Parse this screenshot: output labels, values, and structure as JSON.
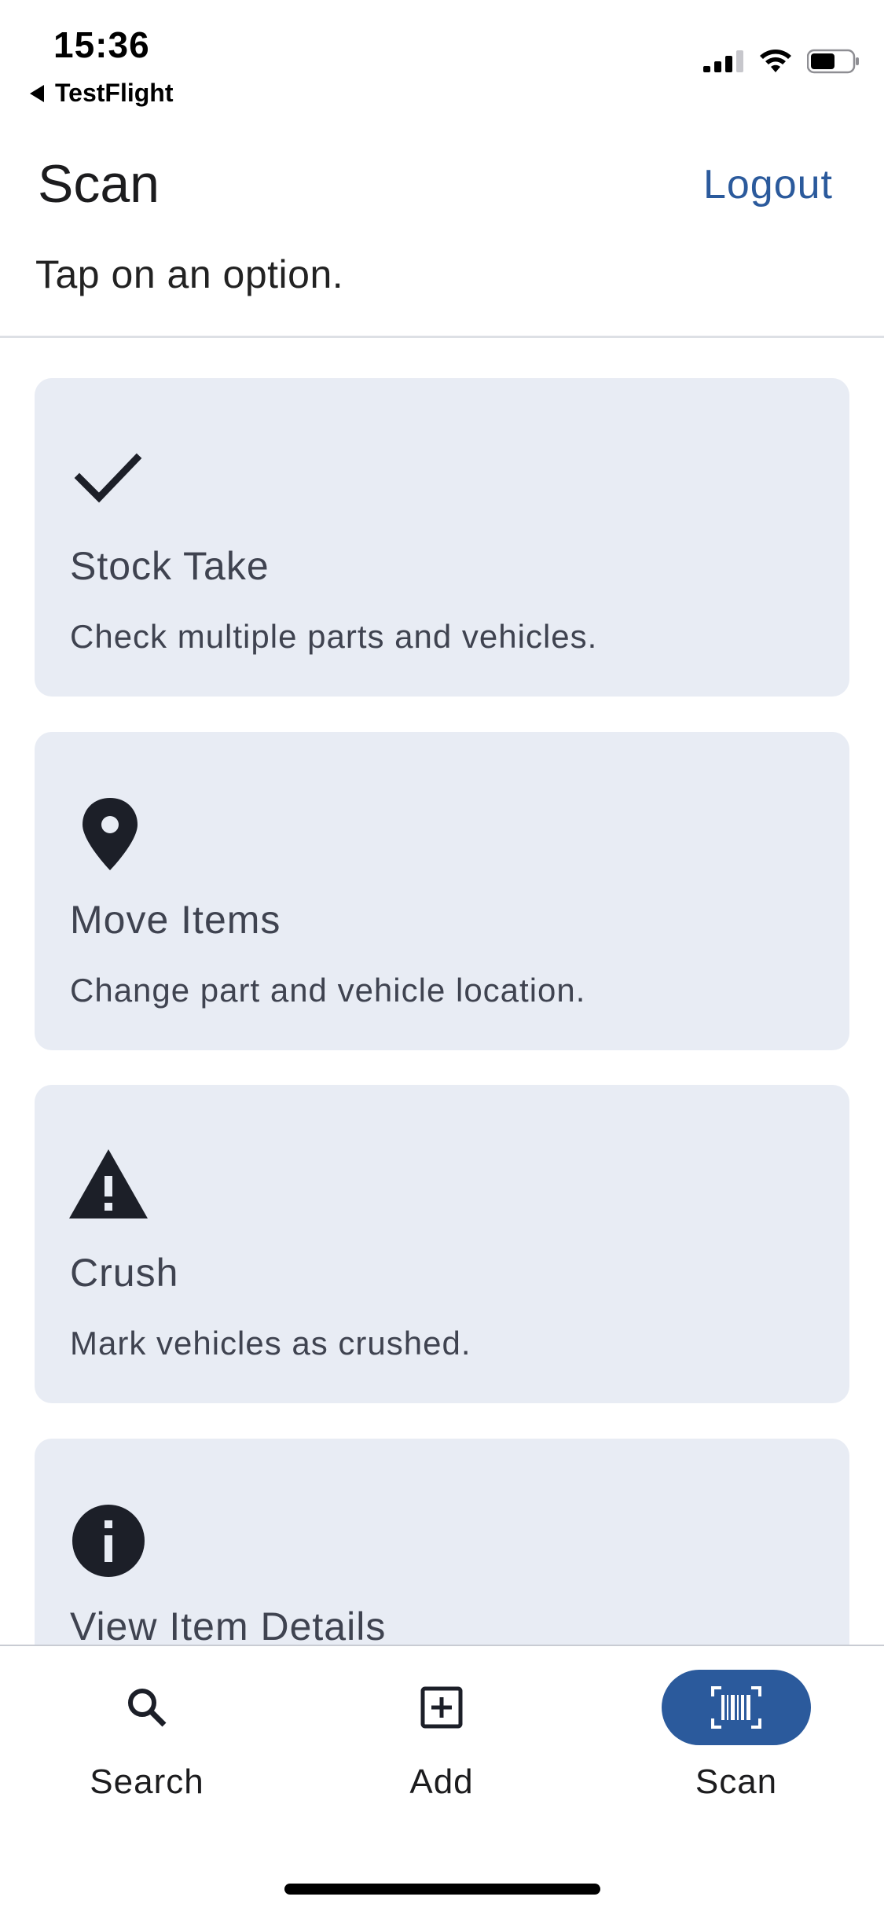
{
  "status_bar": {
    "time": "15:36",
    "back_app": "TestFlight"
  },
  "header": {
    "title": "Scan",
    "logout_label": "Logout",
    "subtitle": "Tap on an option."
  },
  "options": [
    {
      "title": "Stock Take",
      "description": "Check multiple parts and vehicles.",
      "icon": "checkmark-icon"
    },
    {
      "title": "Move Items",
      "description": "Change part and vehicle location.",
      "icon": "location-pin-icon"
    },
    {
      "title": "Crush",
      "description": "Mark vehicles as crushed.",
      "icon": "warning-icon"
    },
    {
      "title": "View Item Details",
      "description": "",
      "icon": "info-icon"
    }
  ],
  "bottom_nav": {
    "items": [
      {
        "label": "Search",
        "icon": "search-icon",
        "active": false
      },
      {
        "label": "Add",
        "icon": "add-box-icon",
        "active": false
      },
      {
        "label": "Scan",
        "icon": "barcode-scan-icon",
        "active": true
      }
    ]
  },
  "colors": {
    "accent": "#2b5a9c",
    "card_background": "#e8ecf4",
    "icon_dark": "#1c1f28",
    "text_muted": "#3f4350"
  }
}
